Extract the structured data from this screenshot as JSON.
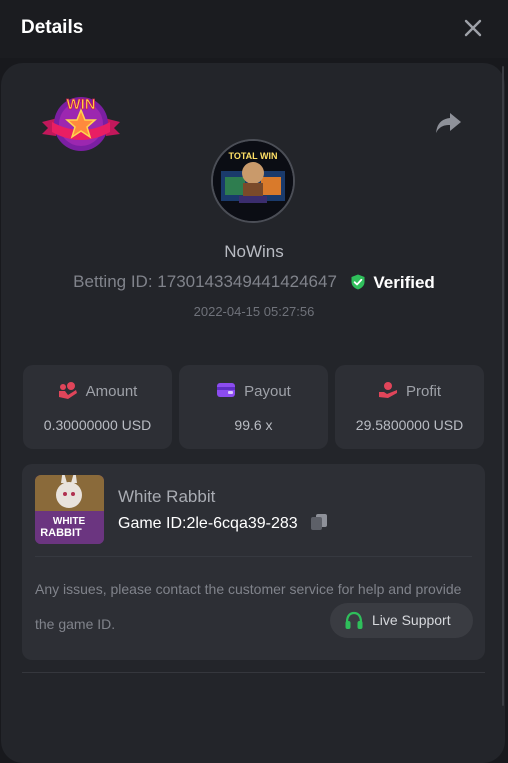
{
  "header": {
    "title": "Details",
    "close_icon": "close-icon"
  },
  "profile": {
    "badge_text": "WIN",
    "avatar_text_top": "TOTAL WIN",
    "username": "NoWins",
    "betting_id_label": "Betting ID:",
    "betting_id": "1730143349441424647",
    "verified_label": "Verified",
    "timestamp": "2022-04-15 05:27:56"
  },
  "stats": [
    {
      "label": "Amount",
      "value": "0.30000000 USD",
      "icon": "coins-icon"
    },
    {
      "label": "Payout",
      "value": "99.6 x",
      "icon": "wallet-icon"
    },
    {
      "label": "Profit",
      "value": "29.5800000 USD",
      "icon": "hand-coins-icon"
    }
  ],
  "game": {
    "name": "White Rabbit",
    "id_label": "Game ID:",
    "id": "2le-6cqa39-283",
    "thumb_text_1": "WHITE",
    "thumb_text_2": "RABBIT",
    "notice": "Any issues, please contact the customer service for help and provide the game ID.",
    "live_support_label": "Live Support"
  },
  "colors": {
    "verified": "#2fbf5b",
    "live_support_icon": "#2fbf5b",
    "stat_icon": "#e0455a",
    "payout_icon": "#8c4cf0"
  }
}
